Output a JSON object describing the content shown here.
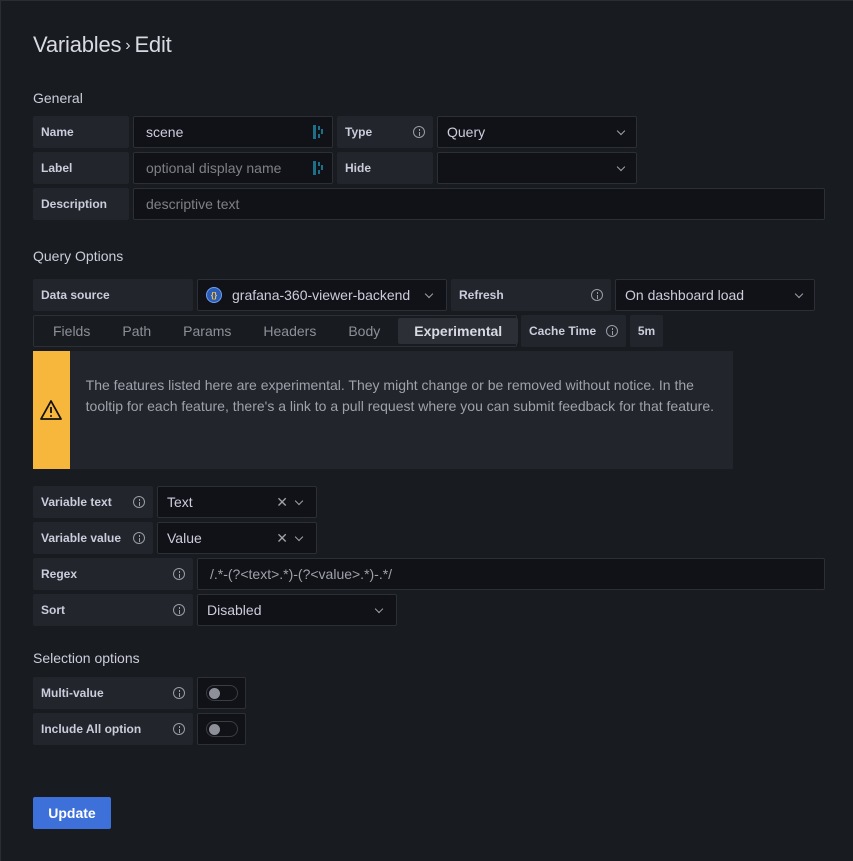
{
  "header": {
    "breadcrumb_parent": "Variables",
    "separator": "›",
    "breadcrumb_current": "Edit"
  },
  "general": {
    "title": "General",
    "name_label": "Name",
    "name_value": "scene",
    "label_label": "Label",
    "label_placeholder": "optional display name",
    "description_label": "Description",
    "description_placeholder": "descriptive text",
    "type_label": "Type",
    "type_value": "Query",
    "hide_label": "Hide",
    "hide_value": ""
  },
  "query_options": {
    "title": "Query Options",
    "datasource_label": "Data source",
    "datasource_value": "grafana-360-viewer-backend",
    "refresh_label": "Refresh",
    "refresh_value": "On dashboard load",
    "tabs": [
      {
        "label": "Fields",
        "active": false
      },
      {
        "label": "Path",
        "active": false
      },
      {
        "label": "Params",
        "active": false
      },
      {
        "label": "Headers",
        "active": false
      },
      {
        "label": "Body",
        "active": false
      },
      {
        "label": "Experimental",
        "active": true
      }
    ],
    "cache_time_label": "Cache Time",
    "cache_time_value": "5m",
    "alert_message": "The features listed here are experimental. They might change or be removed without notice. In the tooltip for each feature, there's a link to a pull request where you can submit feedback for that feature.",
    "alert_color": "#f6b73c",
    "variable_text_label": "Variable text",
    "variable_text_value": "Text",
    "variable_value_label": "Variable value",
    "variable_value_value": "Value",
    "regex_label": "Regex",
    "regex_value": "/.*-(?<text>.*)-(?<value>.*)-.*/",
    "sort_label": "Sort",
    "sort_value": "Disabled"
  },
  "selection_options": {
    "title": "Selection options",
    "multi_value_label": "Multi-value",
    "multi_value_enabled": false,
    "include_all_label": "Include All option",
    "include_all_enabled": false
  },
  "actions": {
    "update_label": "Update",
    "accent_color": "#3d71d9"
  }
}
